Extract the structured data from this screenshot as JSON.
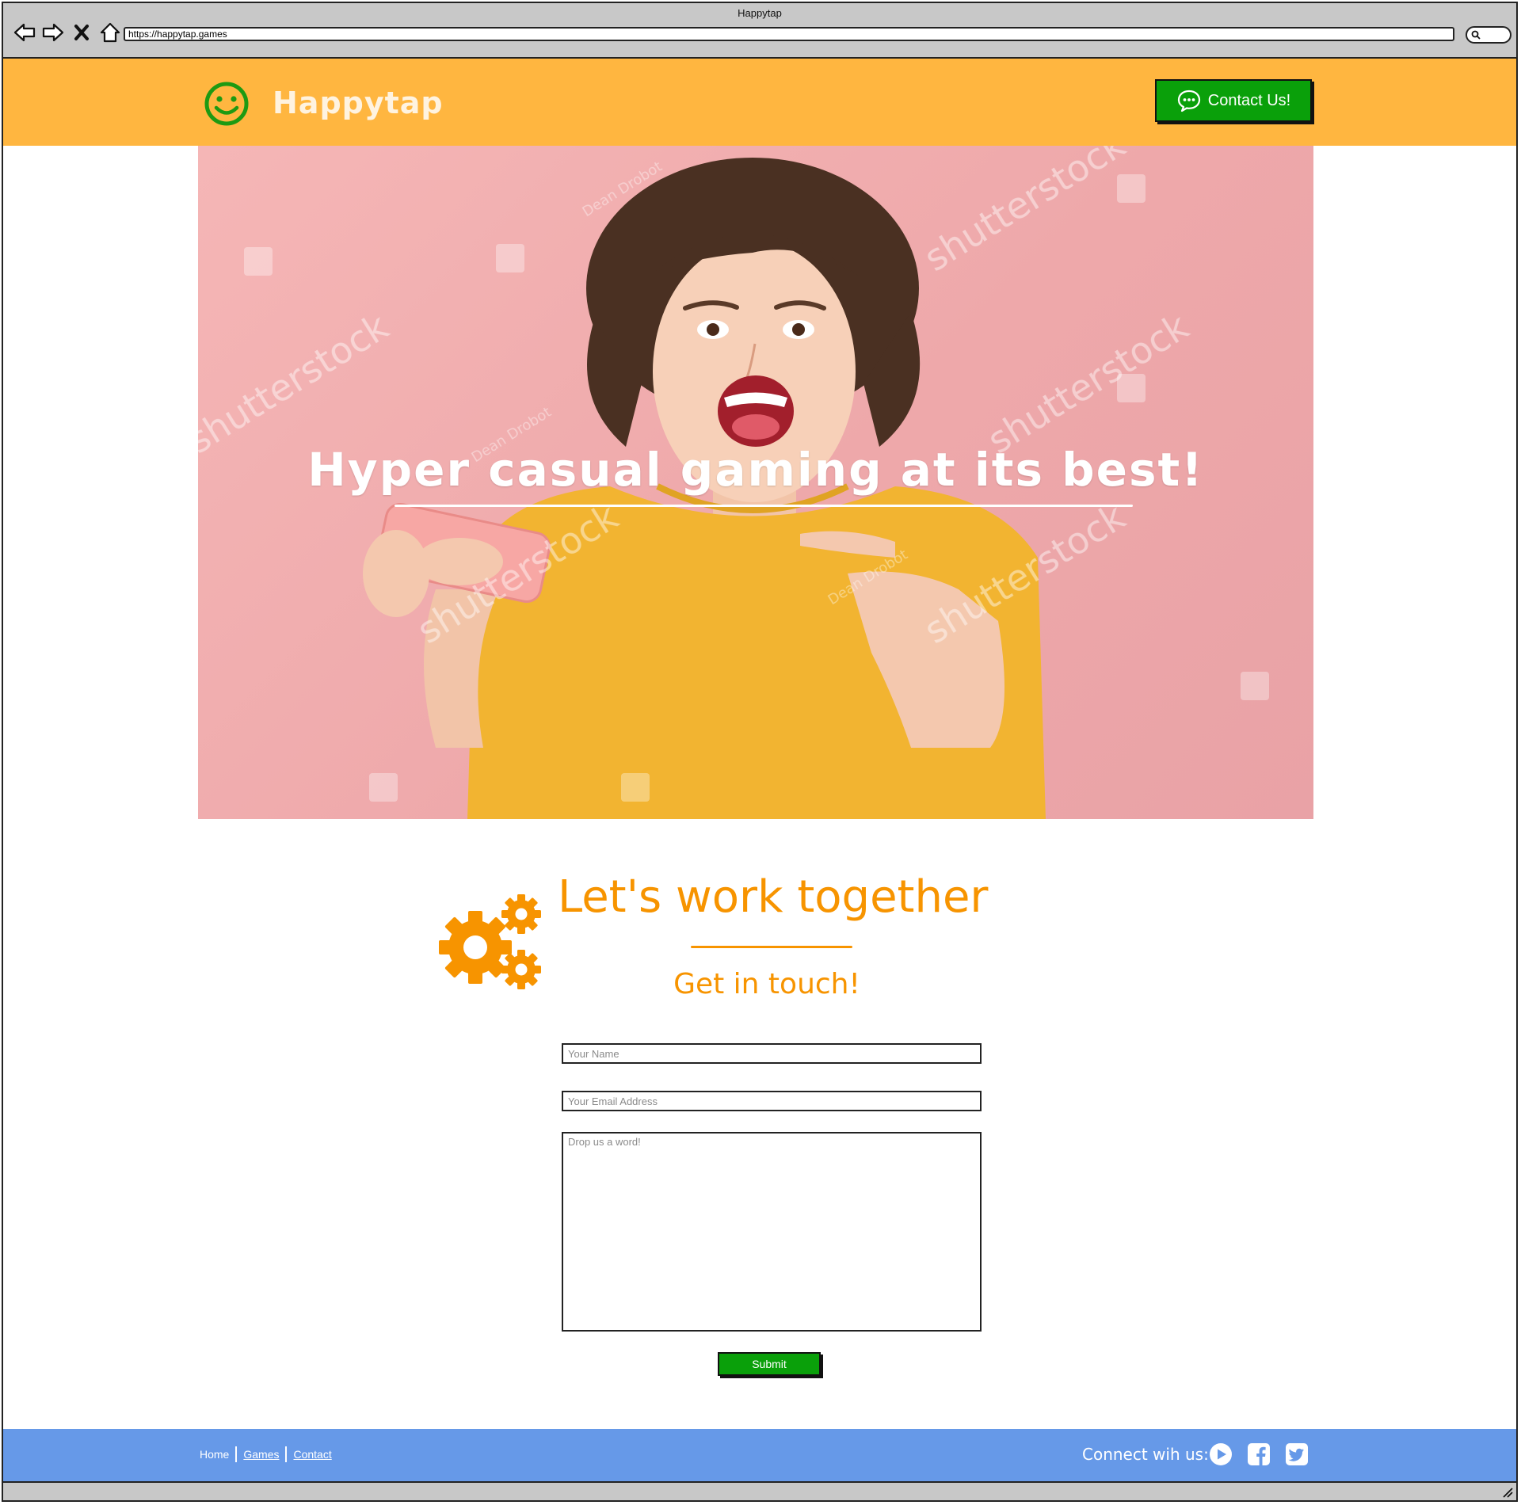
{
  "browser": {
    "window_title": "Happytap",
    "url": "https://happytap.games"
  },
  "header": {
    "brand": "Happytap",
    "logo_icon": "smiley-face-icon",
    "contact_button_label": "Contact Us!",
    "contact_button_icon": "chat-bubble-icon"
  },
  "hero": {
    "headline": "Hyper casual gaming at its best!",
    "watermark_text": "shutterstock",
    "photo_credit": "Dean Drobot"
  },
  "contact_section": {
    "icon": "gears-icon",
    "title": "Let's work together",
    "subtitle": "Get in touch!",
    "name_placeholder": "Your Name",
    "email_placeholder": "Your Email Address",
    "message_placeholder": "Drop us a word!",
    "submit_label": "Submit"
  },
  "footer": {
    "links": [
      "Home",
      "Games",
      "Contact"
    ],
    "connect_label": "Connect wih us:",
    "social_icons": [
      "youtube-play-icon",
      "facebook-icon",
      "twitter-icon"
    ]
  },
  "colors": {
    "header_bg": "#ffb640",
    "accent_orange": "#f79400",
    "button_green": "#0aa00a",
    "footer_blue": "#6699e8",
    "hero_pink": "#f0aeb0"
  }
}
